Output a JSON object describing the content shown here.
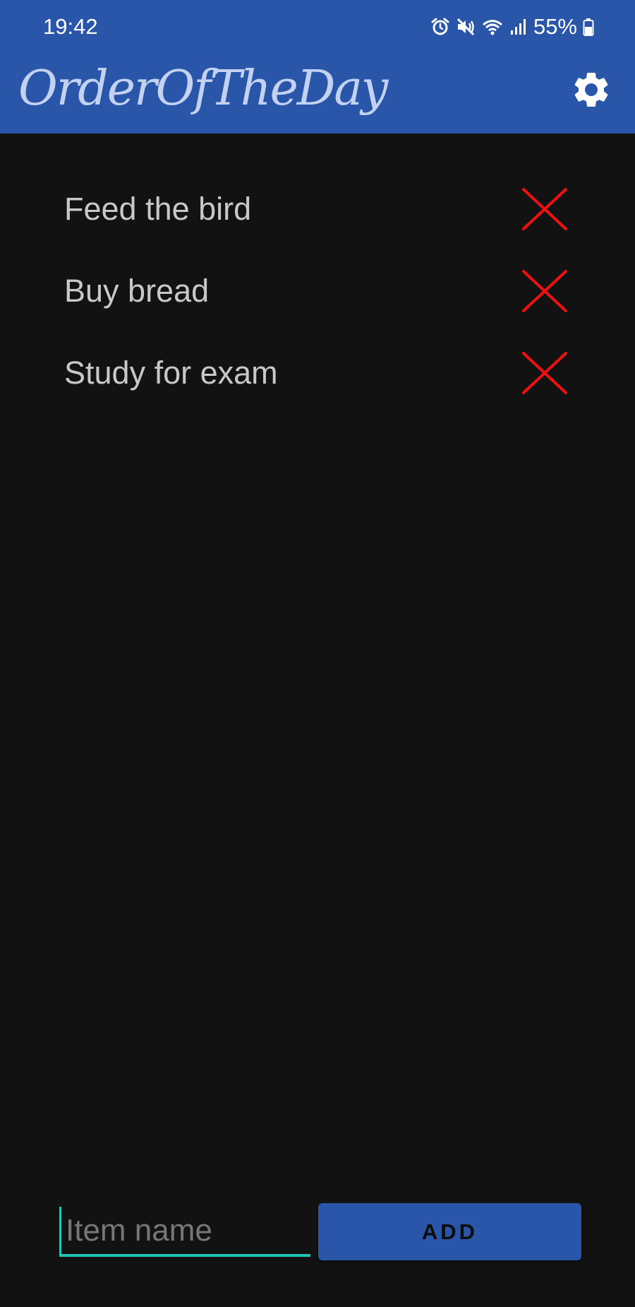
{
  "status_bar": {
    "time": "19:42",
    "battery_percent": "55%",
    "icons": [
      "alarm-icon",
      "mute-icon",
      "wifi-icon",
      "signal-icon",
      "battery-icon"
    ]
  },
  "app": {
    "title": "OrderOfTheDay",
    "settings_icon": "gear-icon",
    "accent_color": "#2a56aa",
    "title_color": "#c3d2f1"
  },
  "tasks": [
    {
      "label": "Feed the bird",
      "delete_icon": "close-icon"
    },
    {
      "label": "Buy bread",
      "delete_icon": "close-icon"
    },
    {
      "label": "Study for exam",
      "delete_icon": "close-icon"
    }
  ],
  "new_item": {
    "placeholder": "Item name",
    "value": "",
    "add_label": "ADD",
    "input_accent_color": "#1fc4b3"
  },
  "colors": {
    "background": "#121212",
    "delete_icon": "#ee1111",
    "task_text": "#c8c8c8"
  }
}
